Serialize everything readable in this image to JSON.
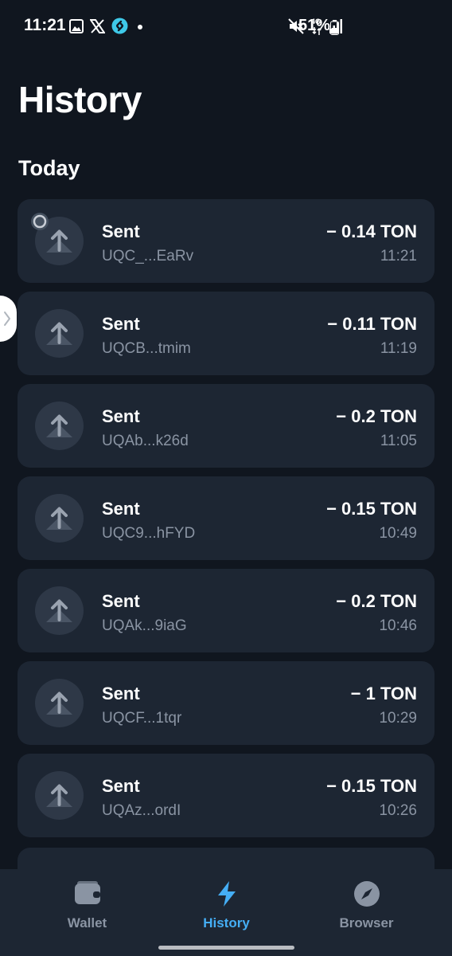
{
  "status_bar": {
    "time": "11:21",
    "battery": "51%",
    "network": "4G",
    "left_icons": [
      "image-icon",
      "x-icon",
      "shazam-icon",
      "dot-icon"
    ],
    "right_icons": [
      "mute-icon",
      "network-4g-icon",
      "signal-icon",
      "battery-icon"
    ]
  },
  "page": {
    "title": "History",
    "section": "Today"
  },
  "transactions": [
    {
      "type": "Sent",
      "address": "UQC_...EaRv",
      "amount": "− 0.14 TON",
      "time": "11:21",
      "pending": true
    },
    {
      "type": "Sent",
      "address": "UQCB...tmim",
      "amount": "− 0.11 TON",
      "time": "11:19",
      "pending": false
    },
    {
      "type": "Sent",
      "address": "UQAb...k26d",
      "amount": "− 0.2 TON",
      "time": "11:05",
      "pending": false
    },
    {
      "type": "Sent",
      "address": "UQC9...hFYD",
      "amount": "− 0.15 TON",
      "time": "10:49",
      "pending": false
    },
    {
      "type": "Sent",
      "address": "UQAk...9iaG",
      "amount": "− 0.2 TON",
      "time": "10:46",
      "pending": false
    },
    {
      "type": "Sent",
      "address": "UQCF...1tqr",
      "amount": "− 1 TON",
      "time": "10:29",
      "pending": false
    },
    {
      "type": "Sent",
      "address": "UQAz...ordI",
      "amount": "− 0.15 TON",
      "time": "10:26",
      "pending": false
    }
  ],
  "tabs": [
    {
      "label": "Wallet",
      "icon": "wallet-icon",
      "active": false
    },
    {
      "label": "History",
      "icon": "lightning-icon",
      "active": true
    },
    {
      "label": "Browser",
      "icon": "compass-icon",
      "active": false
    }
  ],
  "colors": {
    "background": "#10161f",
    "card": "#1d2633",
    "accent": "#45aef5",
    "secondary_text": "#8a94a3"
  }
}
